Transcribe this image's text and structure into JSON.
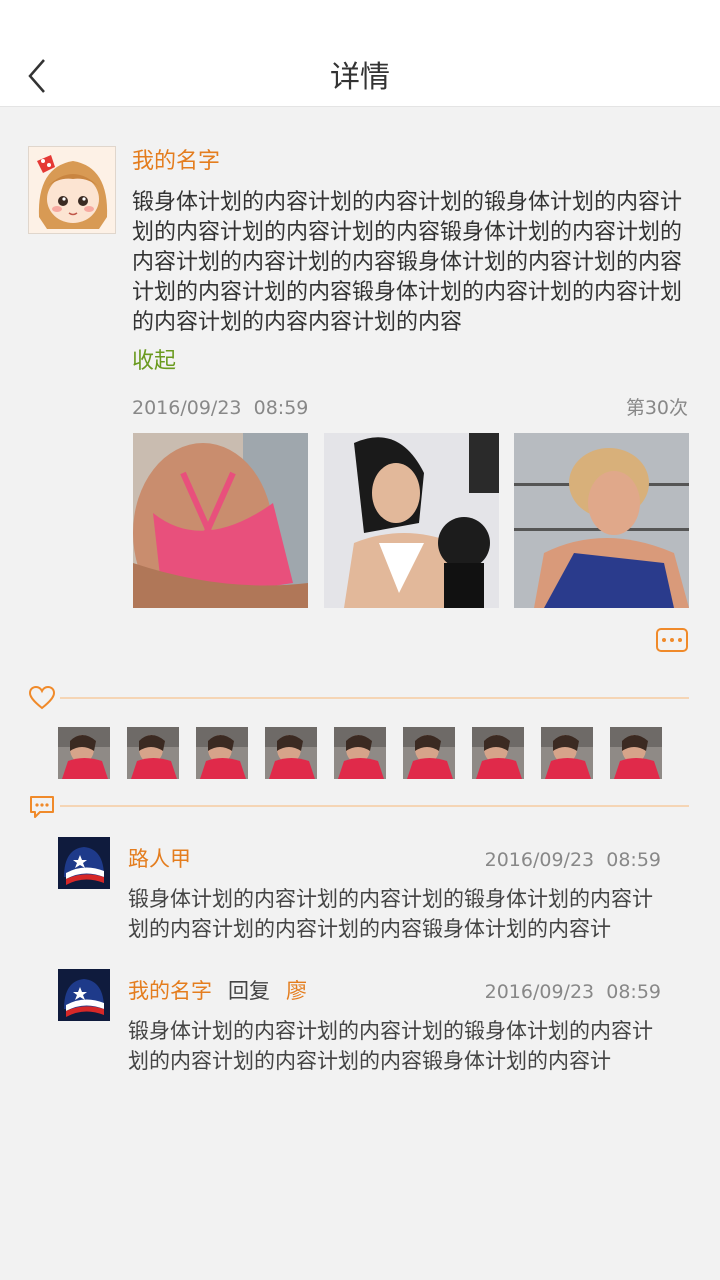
{
  "header": {
    "title": "详情"
  },
  "post": {
    "author": "我的名字",
    "content": "锻身体计划的内容计划的内容计划的锻身体计划的内容计划的内容计划的内容计划的内容锻身体计划的内容计划的内容计划的内容计划的内容锻身体计划的内容计划的内容计划的内容计划的内容锻身体计划的内容计划的内容计划的内容计划的内容内容计划的内容",
    "collapse_label": "收起",
    "date": "2016/09/23",
    "time": "08:59",
    "count": "第30次"
  },
  "likers_count": 9,
  "comments": [
    {
      "name": "路人甲",
      "date": "2016/09/23",
      "time": "08:59",
      "text": "锻身体计划的内容计划的内容计划的锻身体计划的内容计划的内容计划的内容计划的内容锻身体计划的内容计"
    },
    {
      "name": "我的名字",
      "reply_word": "回复",
      "reply_to": "廖",
      "date": "2016/09/23",
      "time": "08:59",
      "text": "锻身体计划的内容计划的内容计划的锻身体计划的内容计划的内容计划的内容计划的内容锻身体计划的内容计"
    }
  ],
  "colors": {
    "accent": "#e47d1e",
    "collapse": "#6a9a1f",
    "divider": "#f5d5b5"
  }
}
